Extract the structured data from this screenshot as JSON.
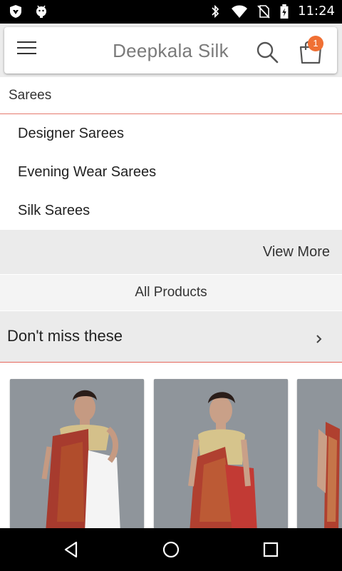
{
  "status_bar": {
    "time": "11:24",
    "icons": [
      "shield-icon",
      "android-icon",
      "bluetooth-icon",
      "wifi-icon",
      "no-sim-icon",
      "battery-charging-icon"
    ]
  },
  "header": {
    "title": "Deepkala Silk",
    "menu_icon": "hamburger-menu-icon",
    "search_icon": "search-icon",
    "cart_icon": "shopping-bag-icon",
    "cart_count": "1",
    "badge_color": "#f07034"
  },
  "category": {
    "title": "Sarees",
    "divider_color": "#e57a6e",
    "items": [
      {
        "label": "Designer Sarees"
      },
      {
        "label": "Evening Wear Sarees"
      },
      {
        "label": "Silk Sarees"
      }
    ],
    "view_more": "View More"
  },
  "all_products": "All Products",
  "dont_miss": {
    "title": "Don't miss these",
    "chevron_icon": "chevron-right-icon"
  },
  "products": [
    {
      "image": "saree-model-photo"
    },
    {
      "image": "saree-model-photo"
    },
    {
      "image": "saree-model-photo"
    }
  ],
  "nav_bar": {
    "icons": [
      "back-icon",
      "home-icon",
      "recents-icon"
    ]
  }
}
